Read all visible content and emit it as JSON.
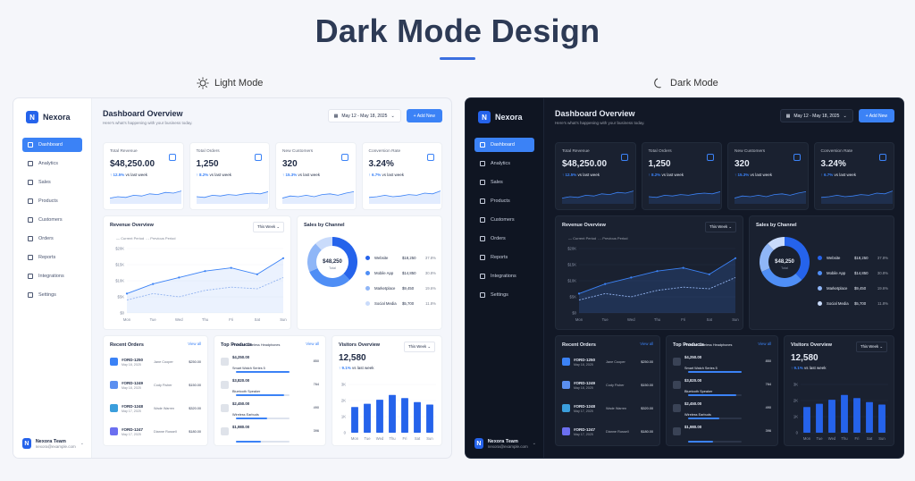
{
  "page": {
    "title": "Dark Mode Design"
  },
  "modes": [
    {
      "label": "Light Mode",
      "icon": "sun-icon"
    },
    {
      "label": "Dark Mode",
      "icon": "moon-icon"
    }
  ],
  "app": {
    "brand": "Nexora",
    "nav": [
      "Dashboard",
      "Analytics",
      "Sales",
      "Products",
      "Customers",
      "Orders",
      "Reports",
      "Integrations",
      "Settings"
    ],
    "active_nav": "Dashboard",
    "user": {
      "name": "Nexora Team",
      "email": "nexora@example.com"
    },
    "header": {
      "title": "Dashboard Overview",
      "subtitle": "Here's what's happening with your business today.",
      "date_range": "May 12 - May 18, 2025",
      "add_button": "+ Add New"
    },
    "kpis": [
      {
        "label": "Total Revenue",
        "value": "$48,250.00",
        "change": "↑ 12.5%",
        "suffix": "vs last week",
        "icon": "wallet-icon"
      },
      {
        "label": "Total Orders",
        "value": "1,250",
        "change": "↑ 8.2%",
        "suffix": "vs last week",
        "icon": "bag-icon"
      },
      {
        "label": "New Customers",
        "value": "320",
        "change": "↑ 15.3%",
        "suffix": "vs last week",
        "icon": "users-icon"
      },
      {
        "label": "Conversion Rate",
        "value": "3.24%",
        "change": "↑ 6.7%",
        "suffix": "vs last week",
        "icon": "target-icon"
      }
    ],
    "revenue": {
      "title": "Revenue Overview",
      "filter": "This Week",
      "legend": [
        "Current Period",
        "Previous Period"
      ]
    },
    "sales": {
      "title": "Sales by Channel",
      "total": "$48,250",
      "total_label": "Total",
      "channels": [
        {
          "name": "Website",
          "value": "$18,250",
          "pct": "37.8%"
        },
        {
          "name": "Mobile App",
          "value": "$14,850",
          "pct": "30.8%"
        },
        {
          "name": "Marketplace",
          "value": "$9,450",
          "pct": "19.6%"
        },
        {
          "name": "Social Media",
          "value": "$5,700",
          "pct": "11.8%"
        }
      ]
    },
    "orders": {
      "title": "Recent Orders",
      "link": "View all",
      "rows": [
        {
          "id": "#ORD-1250",
          "date": "May 18, 2025",
          "name": "Jane Cooper",
          "amount": "$250.00"
        },
        {
          "id": "#ORD-1249",
          "date": "May 18, 2025",
          "name": "Cody Fisher",
          "amount": "$150.00"
        },
        {
          "id": "#ORD-1248",
          "date": "May 17, 2025",
          "name": "Wade Warren",
          "amount": "$320.00"
        },
        {
          "id": "#ORD-1247",
          "date": "May 17, 2025",
          "name": "Dianne Russell",
          "amount": "$180.00"
        }
      ]
    },
    "products": {
      "title": "Top Products",
      "link": "View all",
      "rows": [
        {
          "name": "Premium Wireless Headphones",
          "price": "$4,250.00",
          "qty": "850"
        },
        {
          "name": "Smart Watch Series 5",
          "price": "$3,820.00",
          "qty": "764"
        },
        {
          "name": "Bluetooth Speaker",
          "price": "$2,450.00",
          "qty": "490"
        },
        {
          "name": "Wireless Earbuds",
          "price": "$1,980.00",
          "qty": "396"
        }
      ]
    },
    "visitors": {
      "title": "Visitors Overview",
      "filter": "This Week",
      "value": "12,580",
      "change": "↑ 9.1%",
      "suffix": "vs last week"
    }
  },
  "colors": {
    "accent": "#3b82f6",
    "light_bg": "#ffffff",
    "dark_bg": "#1a2130"
  },
  "chart_data": [
    {
      "type": "line",
      "title": "Revenue Overview",
      "x": [
        "Mon",
        "Tue",
        "Wed",
        "Thu",
        "Fri",
        "Sat",
        "Sun"
      ],
      "ylim": [
        0,
        20000
      ],
      "yticks": [
        "$0",
        "$5K",
        "$10K",
        "$15K",
        "$20K"
      ],
      "series": [
        {
          "name": "Current Period",
          "values": [
            6000,
            9000,
            11000,
            13000,
            14000,
            12000,
            17000
          ]
        },
        {
          "name": "Previous Period",
          "values": [
            4000,
            6000,
            5000,
            7000,
            8000,
            7500,
            11000
          ]
        }
      ]
    },
    {
      "type": "pie",
      "title": "Sales by Channel",
      "categories": [
        "Website",
        "Mobile App",
        "Marketplace",
        "Social Media"
      ],
      "values": [
        37.8,
        30.8,
        19.6,
        11.8
      ]
    },
    {
      "type": "bar",
      "title": "Visitors Overview",
      "categories": [
        "Mon",
        "Tue",
        "Wed",
        "Thu",
        "Fri",
        "Sat",
        "Sun"
      ],
      "values": [
        1600,
        1800,
        2050,
        2350,
        2150,
        1900,
        1750
      ],
      "ylim": [
        0,
        3000
      ],
      "yticks": [
        "0",
        "1K",
        "2K",
        "3K"
      ]
    }
  ]
}
